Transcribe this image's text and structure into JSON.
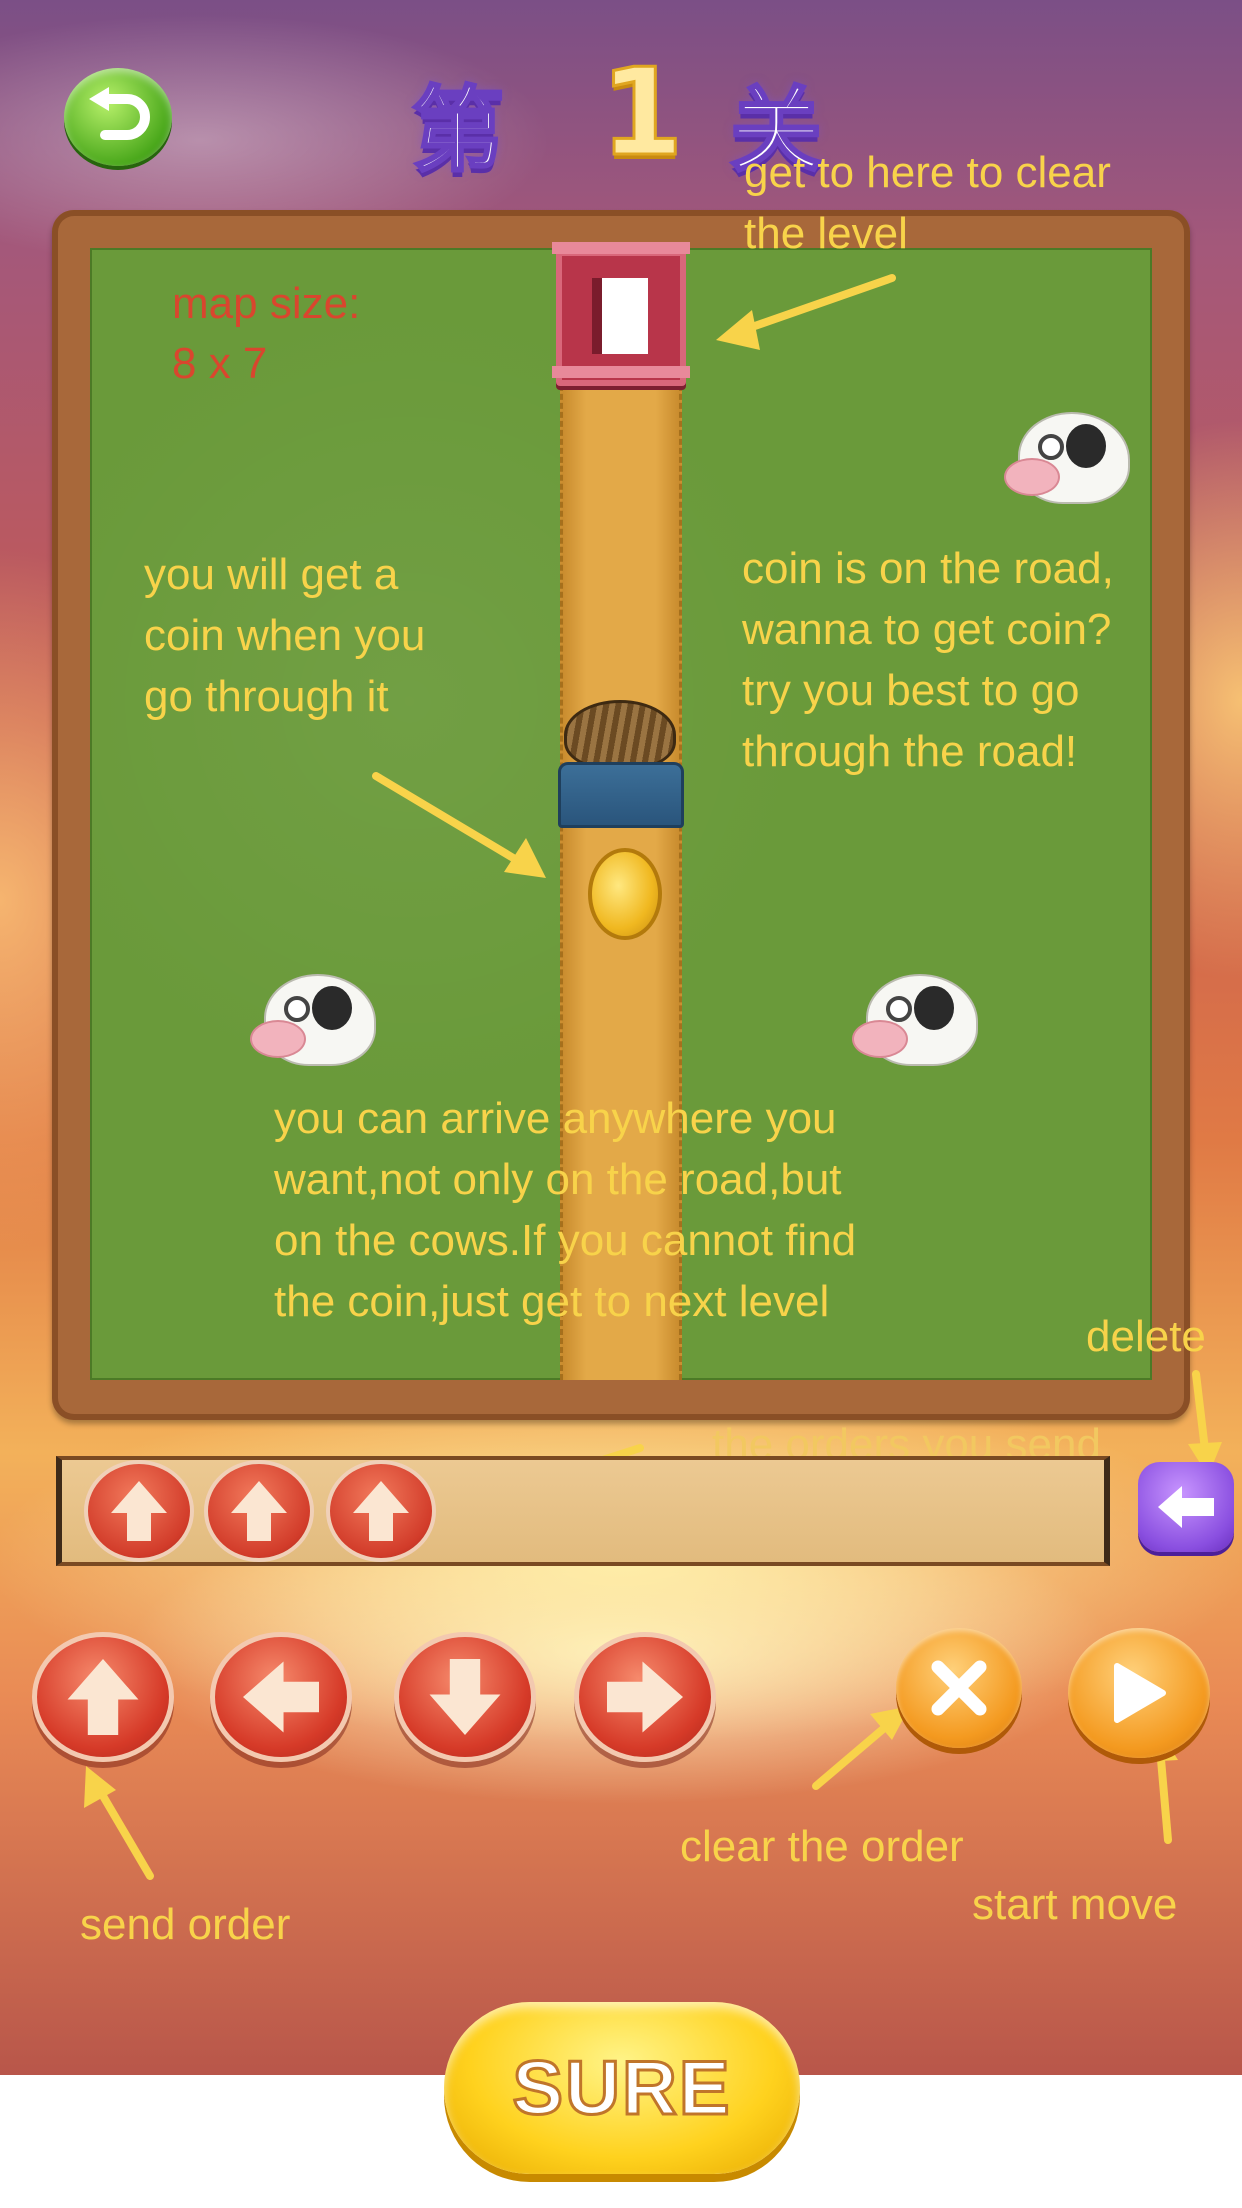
{
  "header": {
    "back_icon": "return-arrow-icon",
    "title_prefix": "第",
    "level_number": "1",
    "title_suffix": "关"
  },
  "board": {
    "map_size_label": "map size:",
    "map_size_value": "8 x 7"
  },
  "annotations": {
    "goal_line1": "get to here to clear",
    "goal_line2": "the level",
    "coin_line1": "you will get a",
    "coin_line2": "coin when you",
    "coin_line3": "go through it",
    "road_line1": "coin is on the road,",
    "road_line2": "wanna to get coin?",
    "road_line3": "try you best to go",
    "road_line4": "through the road!",
    "arrive_line1": "you can arrive anywhere you",
    "arrive_line2": "want,not only on the road,but",
    "arrive_line3": "on the cows.If you cannot find",
    "arrive_line4": "the coin,just get to next level",
    "delete": "delete",
    "orders_sent": "the orders you send",
    "send_order": "send order",
    "clear_order": "clear the order",
    "start_move": "start move"
  },
  "orders": [
    "up",
    "up",
    "up"
  ],
  "controls": {
    "up_icon": "arrow-up-icon",
    "left_icon": "arrow-left-icon",
    "down_icon": "arrow-down-icon",
    "right_icon": "arrow-right-icon",
    "clear_icon": "close-icon",
    "play_icon": "play-icon",
    "delete_icon": "backspace-arrow-icon"
  },
  "sure_button": "SURE",
  "colors": {
    "annotation_yellow": "#f8d34a",
    "annotation_red": "#d9462e",
    "button_red": "#d63a28",
    "button_orange": "#f49a20",
    "sure_yellow": "#ffd21e"
  }
}
